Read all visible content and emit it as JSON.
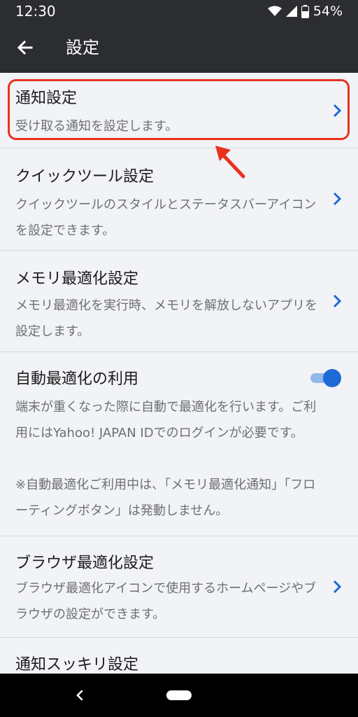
{
  "status_bar": {
    "time": "12:30",
    "battery": "54%",
    "icons": [
      "wifi-icon",
      "cell-signal-icon",
      "battery-icon"
    ]
  },
  "app_bar": {
    "title": "設定",
    "back_icon": "back-arrow-icon"
  },
  "settings": {
    "items": [
      {
        "title": "通知設定",
        "desc": "受け取る通知を設定します。",
        "control": "chevron"
      },
      {
        "title": "クイックツール設定",
        "desc": "クイックツールのスタイルとステータスバーアイコンを設定できます。",
        "control": "chevron"
      },
      {
        "title": "メモリ最適化設定",
        "desc": "メモリ最適化を実行時、メモリを解放しないアプリを設定します。",
        "control": "chevron"
      },
      {
        "title": "自動最適化の利用",
        "desc": "端末が重くなった際に自動で最適化を行います。ご利用にはYahoo! JAPAN IDでのログインが必要です。",
        "note": "※自動最適化ご利用中は、「メモリ最適化通知」「フローティングボタン」は発動しません。",
        "control": "toggle",
        "toggle_on": true
      },
      {
        "title": "ブラウザ最適化設定",
        "desc": "ブラウザ最適化アイコンで使用するホームページやブラウザの設定ができます。",
        "control": "chevron"
      },
      {
        "title": "通知スッキリ設定",
        "control": "chevron"
      }
    ]
  },
  "annotation": {
    "highlight_color": "#e8321e"
  },
  "colors": {
    "bar_bg": "#2b2d30",
    "list_bg": "#f1f3f6",
    "accent": "#1e6ad6"
  },
  "nav_bar": {
    "icons": [
      "nav-back-icon",
      "nav-home-pill"
    ]
  }
}
